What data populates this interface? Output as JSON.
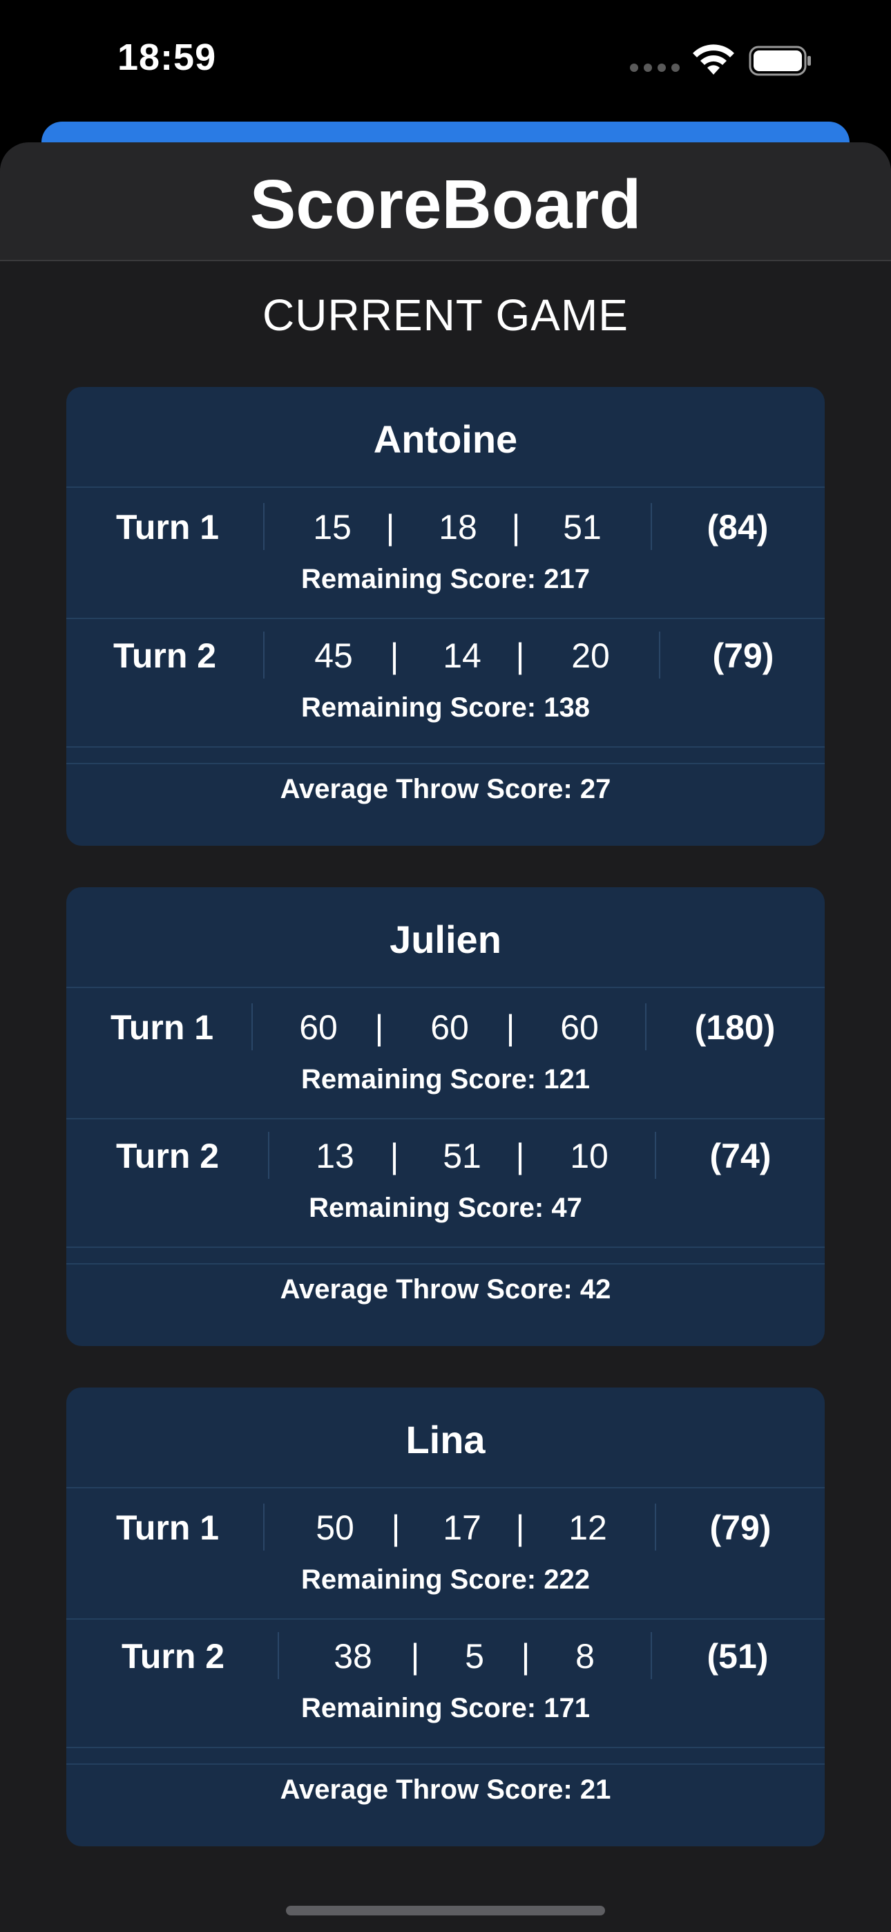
{
  "status_bar": {
    "time": "18:59",
    "icons": [
      "signal-dots-icon",
      "wifi-icon",
      "battery-icon"
    ]
  },
  "header": {
    "title": "ScoreBoard"
  },
  "section": {
    "title": "CURRENT GAME"
  },
  "labels": {
    "remaining_prefix": "Remaining Score:",
    "average_prefix": "Average Throw Score:"
  },
  "players": [
    {
      "name": "Antoine",
      "turns": [
        {
          "label": "Turn 1",
          "throws": [
            "15",
            "18",
            "51"
          ],
          "total": "(84)",
          "remaining": "Remaining Score: 217"
        },
        {
          "label": "Turn 2",
          "throws": [
            "45",
            "14",
            "20"
          ],
          "total": "(79)",
          "remaining": "Remaining Score: 138"
        }
      ],
      "average": "Average Throw Score: 27"
    },
    {
      "name": "Julien",
      "turns": [
        {
          "label": "Turn 1",
          "throws": [
            "60",
            "60",
            "60"
          ],
          "total": "(180)",
          "remaining": "Remaining Score: 121"
        },
        {
          "label": "Turn 2",
          "throws": [
            "13",
            "51",
            "10"
          ],
          "total": "(74)",
          "remaining": "Remaining Score: 47"
        }
      ],
      "average": "Average Throw Score: 42"
    },
    {
      "name": "Lina",
      "turns": [
        {
          "label": "Turn 1",
          "throws": [
            "50",
            "17",
            "12"
          ],
          "total": "(79)",
          "remaining": "Remaining Score: 222"
        },
        {
          "label": "Turn 2",
          "throws": [
            "38",
            "5",
            "8"
          ],
          "total": "(51)",
          "remaining": "Remaining Score: 171"
        }
      ],
      "average": "Average Throw Score: 21"
    }
  ],
  "colors": {
    "background": "#1c1c1e",
    "card": "#182d48",
    "accent": "#2a7be4"
  }
}
